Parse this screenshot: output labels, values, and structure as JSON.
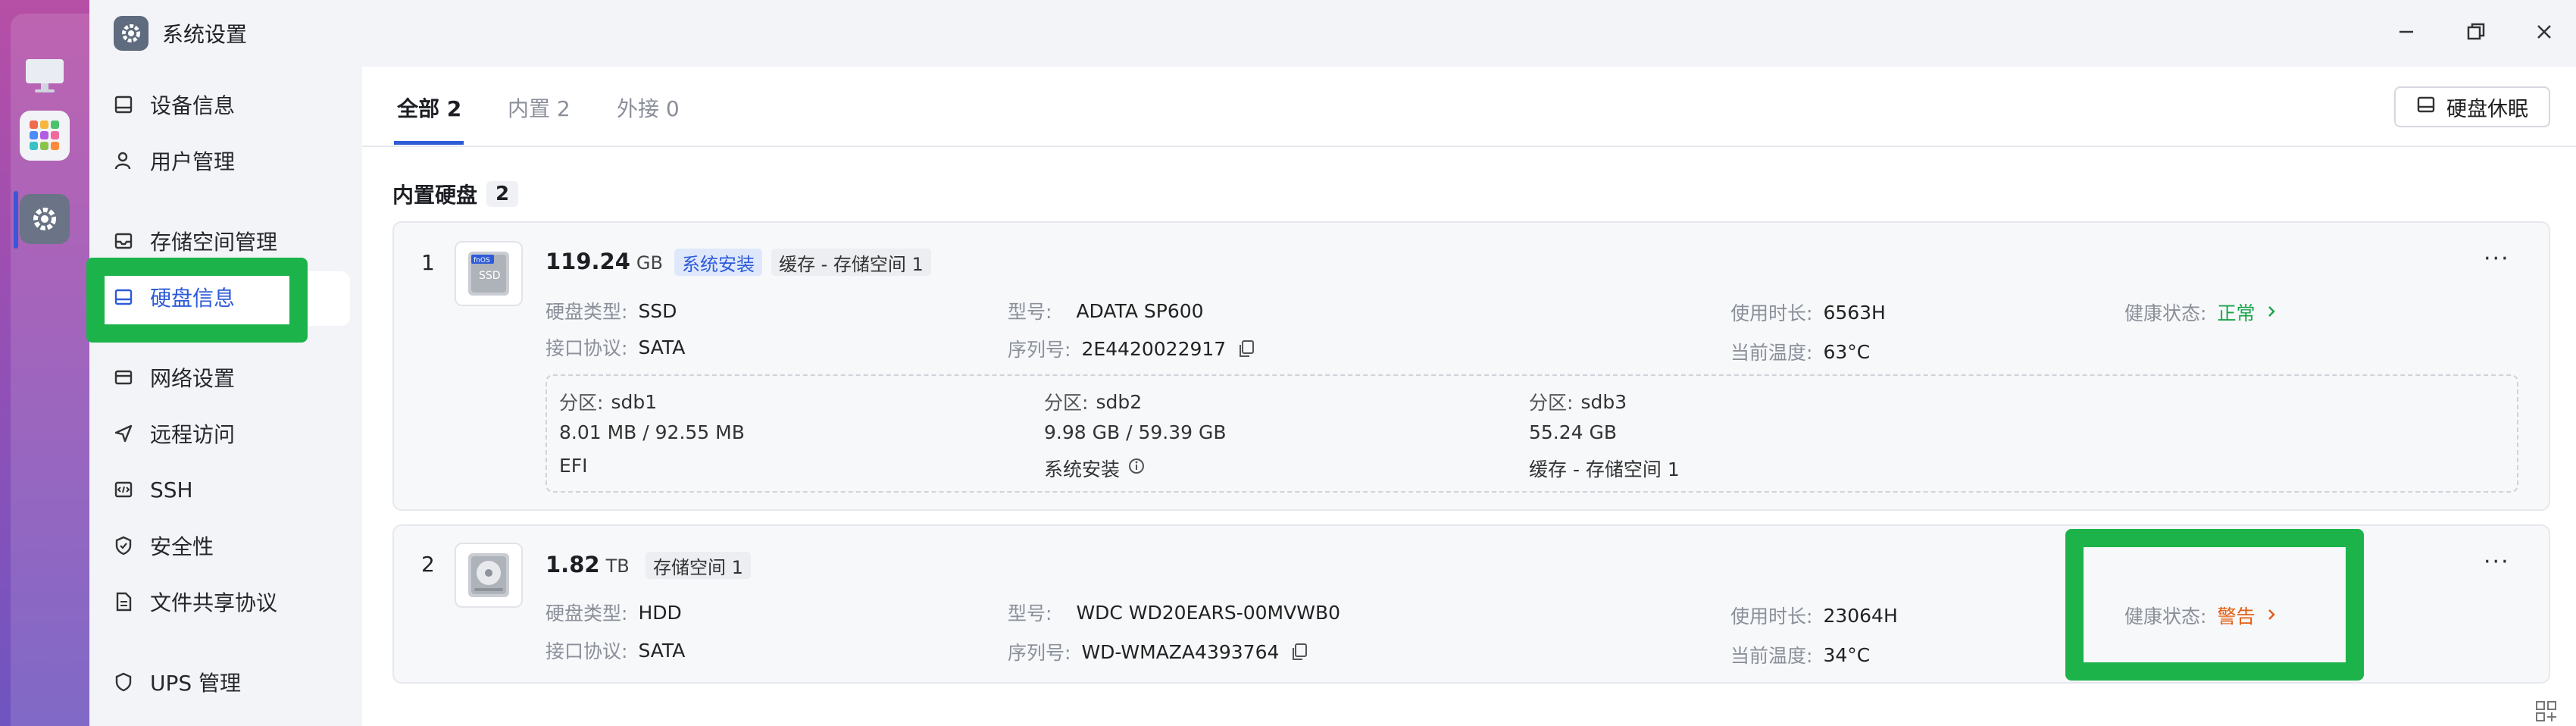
{
  "app": {
    "title": "系统设置"
  },
  "sidebar": {
    "items": [
      {
        "label": "设备信息",
        "icon": "device-info-icon"
      },
      {
        "label": "用户管理",
        "icon": "user-icon"
      },
      {
        "label": "存储空间管理",
        "icon": "storage-icon"
      },
      {
        "label": "硬盘信息",
        "icon": "disk-icon",
        "active": true
      },
      {
        "label": "网络设置",
        "icon": "network-icon"
      },
      {
        "label": "远程访问",
        "icon": "remote-icon"
      },
      {
        "label": "SSH",
        "icon": "ssh-icon"
      },
      {
        "label": "安全性",
        "icon": "shield-icon"
      },
      {
        "label": "文件共享协议",
        "icon": "file-share-icon"
      },
      {
        "label": "UPS 管理",
        "icon": "ups-icon"
      }
    ]
  },
  "tabs": [
    {
      "label": "全部 2",
      "active": true
    },
    {
      "label": "内置 2"
    },
    {
      "label": "外接 0"
    }
  ],
  "toolbar": {
    "sleep_label": "硬盘休眠"
  },
  "section": {
    "title": "内置硬盘",
    "count": "2"
  },
  "disks": [
    {
      "index": "1",
      "capacity": "119.24",
      "unit": "GB",
      "disk_label": "SSD",
      "logo_text": "fnOS",
      "tags": [
        "系统安装",
        "缓存 - 存储空间 1"
      ],
      "type_key": "硬盘类型:",
      "type_val": "SSD",
      "iface_key": "接口协议:",
      "iface_val": "SATA",
      "model_key": "型号:",
      "model_val": "ADATA SP600",
      "serial_key": "序列号:",
      "serial_val": "2E4420022917",
      "hours_key": "使用时长:",
      "hours_val": "6563H",
      "temp_key": "当前温度:",
      "temp_val": "63°C",
      "health_key": "健康状态:",
      "health_val": "正常",
      "partitions": [
        {
          "name_key": "分区:",
          "name": "sdb1",
          "size": "8.01 MB / 92.55 MB",
          "usage": "EFI"
        },
        {
          "name_key": "分区:",
          "name": "sdb2",
          "size": "9.98 GB / 59.39 GB",
          "usage": "系统安装"
        },
        {
          "name_key": "分区:",
          "name": "sdb3",
          "size": "55.24 GB",
          "usage": "缓存 - 存储空间 1"
        }
      ]
    },
    {
      "index": "2",
      "capacity": "1.82",
      "unit": "TB",
      "tags": [
        "存储空间 1"
      ],
      "type_key": "硬盘类型:",
      "type_val": "HDD",
      "iface_key": "接口协议:",
      "iface_val": "SATA",
      "model_key": "型号:",
      "model_val": "WDC WD20EARS-00MVWB0",
      "serial_key": "序列号:",
      "serial_val": "WD-WMAZA4393764",
      "hours_key": "使用时长:",
      "hours_val": "23064H",
      "temp_key": "当前温度:",
      "temp_val": "34°C",
      "health_key": "健康状态:",
      "health_val": "警告"
    }
  ],
  "colors": {
    "accent": "#2e5bd8",
    "highlight": "#1bb34a",
    "ok": "#1aa34a",
    "warn": "#e25d12"
  }
}
